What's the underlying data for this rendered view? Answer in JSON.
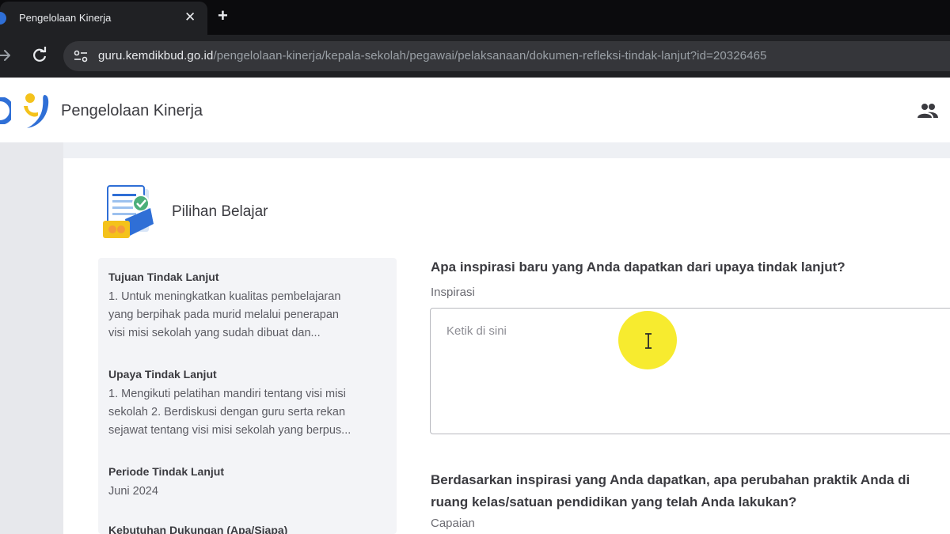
{
  "browser": {
    "tab_title": "Pengelolaan Kinerja",
    "tab_close": "✕",
    "new_tab": "+",
    "url_domain": "guru.kemdikbud.go.id",
    "url_path": "/pengelolaan-kinerja/kepala-sekolah/pegawai/pelaksanaan/dokumen-refleksi-tindak-lanjut?id=20326465"
  },
  "app": {
    "title": "Pengelolaan Kinerja"
  },
  "card": {
    "title": "Pilihan Belajar"
  },
  "summary": {
    "items": [
      {
        "heading": "Tujuan Tindak Lanjut",
        "lines": [
          "1. Untuk meningkatkan kualitas pembelajaran",
          "yang berpihak pada murid melalui penerapan",
          "visi misi sekolah yang sudah dibuat dan..."
        ]
      },
      {
        "heading": "Upaya Tindak Lanjut",
        "lines": [
          "1. Mengikuti pelatihan mandiri tentang visi misi",
          "sekolah 2. Berdiskusi dengan guru serta rekan",
          "sejawat tentang visi misi sekolah yang berpus..."
        ]
      },
      {
        "heading": "Periode Tindak Lanjut",
        "lines": [
          "Juni 2024"
        ]
      },
      {
        "heading": "Kebutuhan Dukungan (Apa/Siapa)",
        "lines": []
      }
    ]
  },
  "form": {
    "question1": "Apa inspirasi baru yang Anda dapatkan dari upaya tindak lanjut?",
    "label1": "Inspirasi",
    "placeholder1": "Ketik di sini",
    "question2_line1": "Berdasarkan inspirasi yang Anda dapatkan, apa perubahan praktik Anda di",
    "question2_line2": "ruang kelas/satuan pendidikan yang telah Anda lakukan?",
    "label2": "Capaian"
  },
  "colors": {
    "cursor_highlight": "#f6ea1f",
    "logo_blue": "#2f6fd6",
    "logo_yellow": "#f4c21b"
  }
}
